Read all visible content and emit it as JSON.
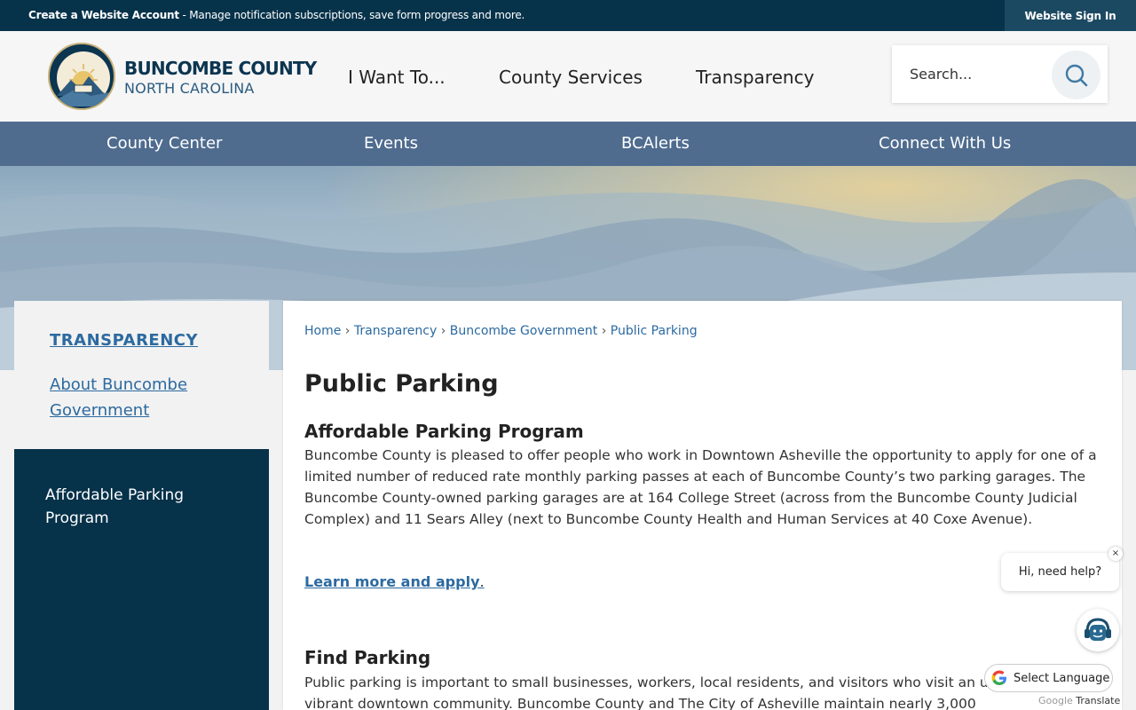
{
  "topbar": {
    "create_bold": "Create a Website Account",
    "create_text": " - Manage notification subscriptions, save form progress and more.",
    "signin": "Website Sign In"
  },
  "header": {
    "logo_line1": "BUNCOMBE COUNTY",
    "logo_line2": "NORTH CAROLINA",
    "nav": [
      "I Want To...",
      "County Services",
      "Transparency"
    ],
    "search_placeholder": "Search..."
  },
  "subnav": [
    "County Center",
    "Events",
    "BCAlerts",
    "Connect With Us"
  ],
  "sidebar": {
    "section": "TRANSPARENCY",
    "link": "About Buncombe Government",
    "active": "Affordable Parking Program"
  },
  "breadcrumb": [
    "Home",
    "Transparency",
    "Buncombe Government",
    "Public Parking"
  ],
  "breadcrumb_sep": "›",
  "page": {
    "title": "Public Parking",
    "h_affordable": "Affordable Parking Program",
    "p_affordable": "Buncombe County is pleased to offer people who work in Downtown Asheville the opportunity to apply for one of a limited number of reduced rate monthly parking passes at each of Buncombe County’s two parking garages. The Buncombe County-owned parking garages are at 164 College Street (across from the Buncombe County Judicial Complex) and 11 Sears Alley (next to Buncombe County Health and Human Services at 40 Coxe Avenue).",
    "learn_more": "Learn more and apply",
    "learn_period": ".",
    "h_find": "Find Parking",
    "p_find": "Public parking is important to small businesses, workers, local residents, and visitors who visit an unique and vibrant downtown community. Buncombe County and The City of Asheville maintain nearly 3,000"
  },
  "chat": {
    "bubble": "Hi, need help?",
    "close": "×"
  },
  "translate": {
    "label": "Select Language",
    "credit_brand": "Google",
    "credit": "Translate"
  }
}
